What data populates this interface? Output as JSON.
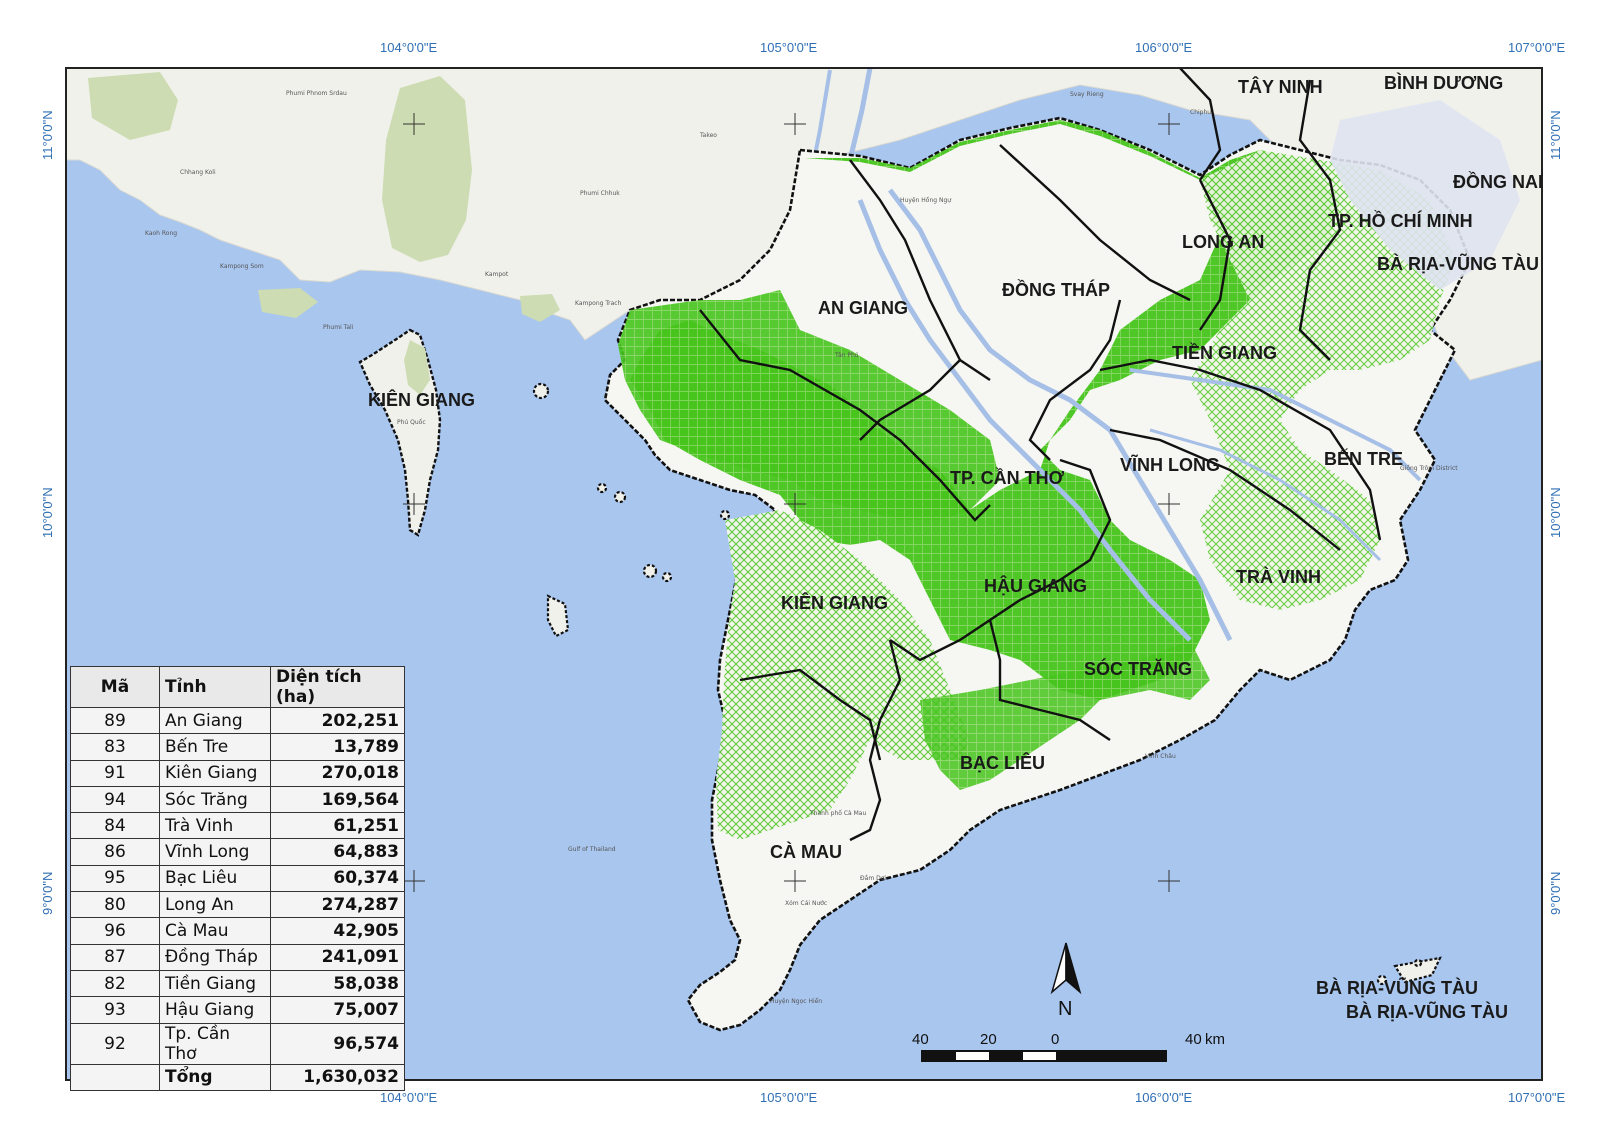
{
  "colors": {
    "sea": "#a9c6ef",
    "land": "#f1f1ec",
    "delta_land": "#f6f6f2",
    "cropland": "#42c41a",
    "border": "#111111",
    "coord_label": "#2f6fb5"
  },
  "graticule": {
    "lon_top": [
      "104°0'0\"E",
      "105°0'0\"E",
      "106°0'0\"E",
      "107°0'0\"E"
    ],
    "lon_bottom": [
      "104°0'0\"E",
      "105°0'0\"E",
      "106°0'0\"E",
      "107°0'0\"E"
    ],
    "lat_left": [
      "11°0'0\"N",
      "10°0'0\"N",
      "9°0'0\"N"
    ],
    "lat_right": [
      "11°0'0\"N",
      "10°0'0\"N",
      "9°0'0\"N"
    ]
  },
  "province_labels": [
    "TÂY NINH",
    "BÌNH DƯƠNG",
    "ĐỒNG NAI",
    "TP. HỒ CHÍ MINH",
    "BÀ RỊA-VŨNG TÀU",
    "LONG AN",
    "ĐỒNG THÁP",
    "AN GIANG",
    "TIỀN GIANG",
    "KIÊN GIANG",
    "KIÊN GIANG",
    "TP. CẦN THƠ",
    "VĨNH LONG",
    "BẾN TRE",
    "HẬU GIANG",
    "TRÀ VINH",
    "SÓC TRĂNG",
    "BẠC LIÊU",
    "CÀ MAU",
    "BÀ RỊA-VŨNG TÀU",
    "BÀ RỊA-VŨNG TÀU"
  ],
  "north_arrow": {
    "label": "N",
    "icon": "north-arrow-icon"
  },
  "scale_bar": {
    "ticks": [
      "40",
      "20",
      "0",
      "40"
    ],
    "unit": "km"
  },
  "table": {
    "headers": [
      "Mã",
      "Tỉnh",
      "Diện tích (ha)"
    ],
    "rows": [
      {
        "code": "89",
        "name": "An Giang",
        "area": "202,251"
      },
      {
        "code": "83",
        "name": "Bến Tre",
        "area": "13,789"
      },
      {
        "code": "91",
        "name": "Kiên Giang",
        "area": "270,018"
      },
      {
        "code": "94",
        "name": "Sóc Trăng",
        "area": "169,564"
      },
      {
        "code": "84",
        "name": "Trà Vinh",
        "area": "61,251"
      },
      {
        "code": "86",
        "name": "Vĩnh Long",
        "area": "64,883"
      },
      {
        "code": "95",
        "name": "Bạc Liêu",
        "area": "60,374"
      },
      {
        "code": "80",
        "name": "Long An",
        "area": "274,287"
      },
      {
        "code": "96",
        "name": "Cà Mau",
        "area": "42,905"
      },
      {
        "code": "87",
        "name": "Đồng Tháp",
        "area": "241,091"
      },
      {
        "code": "82",
        "name": "Tiền Giang",
        "area": "58,038"
      },
      {
        "code": "93",
        "name": "Hậu Giang",
        "area": "75,007"
      },
      {
        "code": "92",
        "name": "Tp. Cần Thơ",
        "area": "96,574"
      }
    ],
    "total": {
      "code": "",
      "name": "Tổng",
      "area": "1,630,032"
    }
  }
}
